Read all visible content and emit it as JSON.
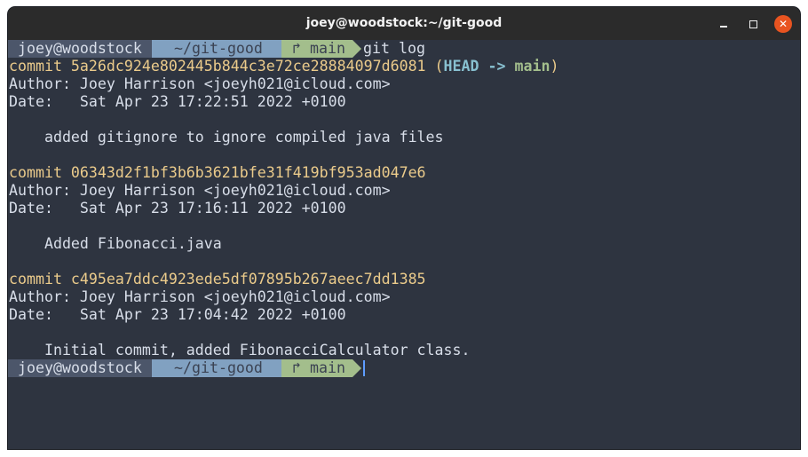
{
  "window": {
    "title": "joey@woodstock:~/git-good",
    "minimize_glyph": "—",
    "close_glyph": "✕"
  },
  "prompt": {
    "user": "joey@woodstock",
    "dir": "~/git-good",
    "branch": "↱ main",
    "command": "git log"
  },
  "commits": [
    {
      "commit_label": "commit 5a26dc924e802445b844c3e72ce28884097d6081",
      "ref_open": " (",
      "ref_head": "HEAD -> ",
      "ref_branch": "main",
      "ref_close": ")",
      "author": "Author: Joey Harrison <joeyh021@icloud.com>",
      "date": "Date:   Sat Apr 23 17:22:51 2022 +0100",
      "message": "    added gitignore to ignore compiled java files"
    },
    {
      "commit_label": "commit 06343d2f1bf3b6b3621bfe31f419bf953ad047e6",
      "author": "Author: Joey Harrison <joeyh021@icloud.com>",
      "date": "Date:   Sat Apr 23 17:16:11 2022 +0100",
      "message": "    Added Fibonacci.java"
    },
    {
      "commit_label": "commit c495ea7ddc4923ede5df07895b267aeec7dd1385",
      "author": "Author: Joey Harrison <joeyh021@icloud.com>",
      "date": "Date:   Sat Apr 23 17:04:42 2022 +0100",
      "message": "    Initial commit, added FibonacciCalculator class."
    }
  ],
  "colors": {
    "background": "#2e3440",
    "titlebar": "#2b2b2b",
    "prompt_user_bg": "#4c566a",
    "prompt_dir_bg": "#81a1c1",
    "prompt_branch_bg": "#a3be8c",
    "commit_hash": "#ebcb8b",
    "head_ref": "#88c0d0",
    "branch_ref": "#a3be8c",
    "close_button": "#e95420"
  }
}
